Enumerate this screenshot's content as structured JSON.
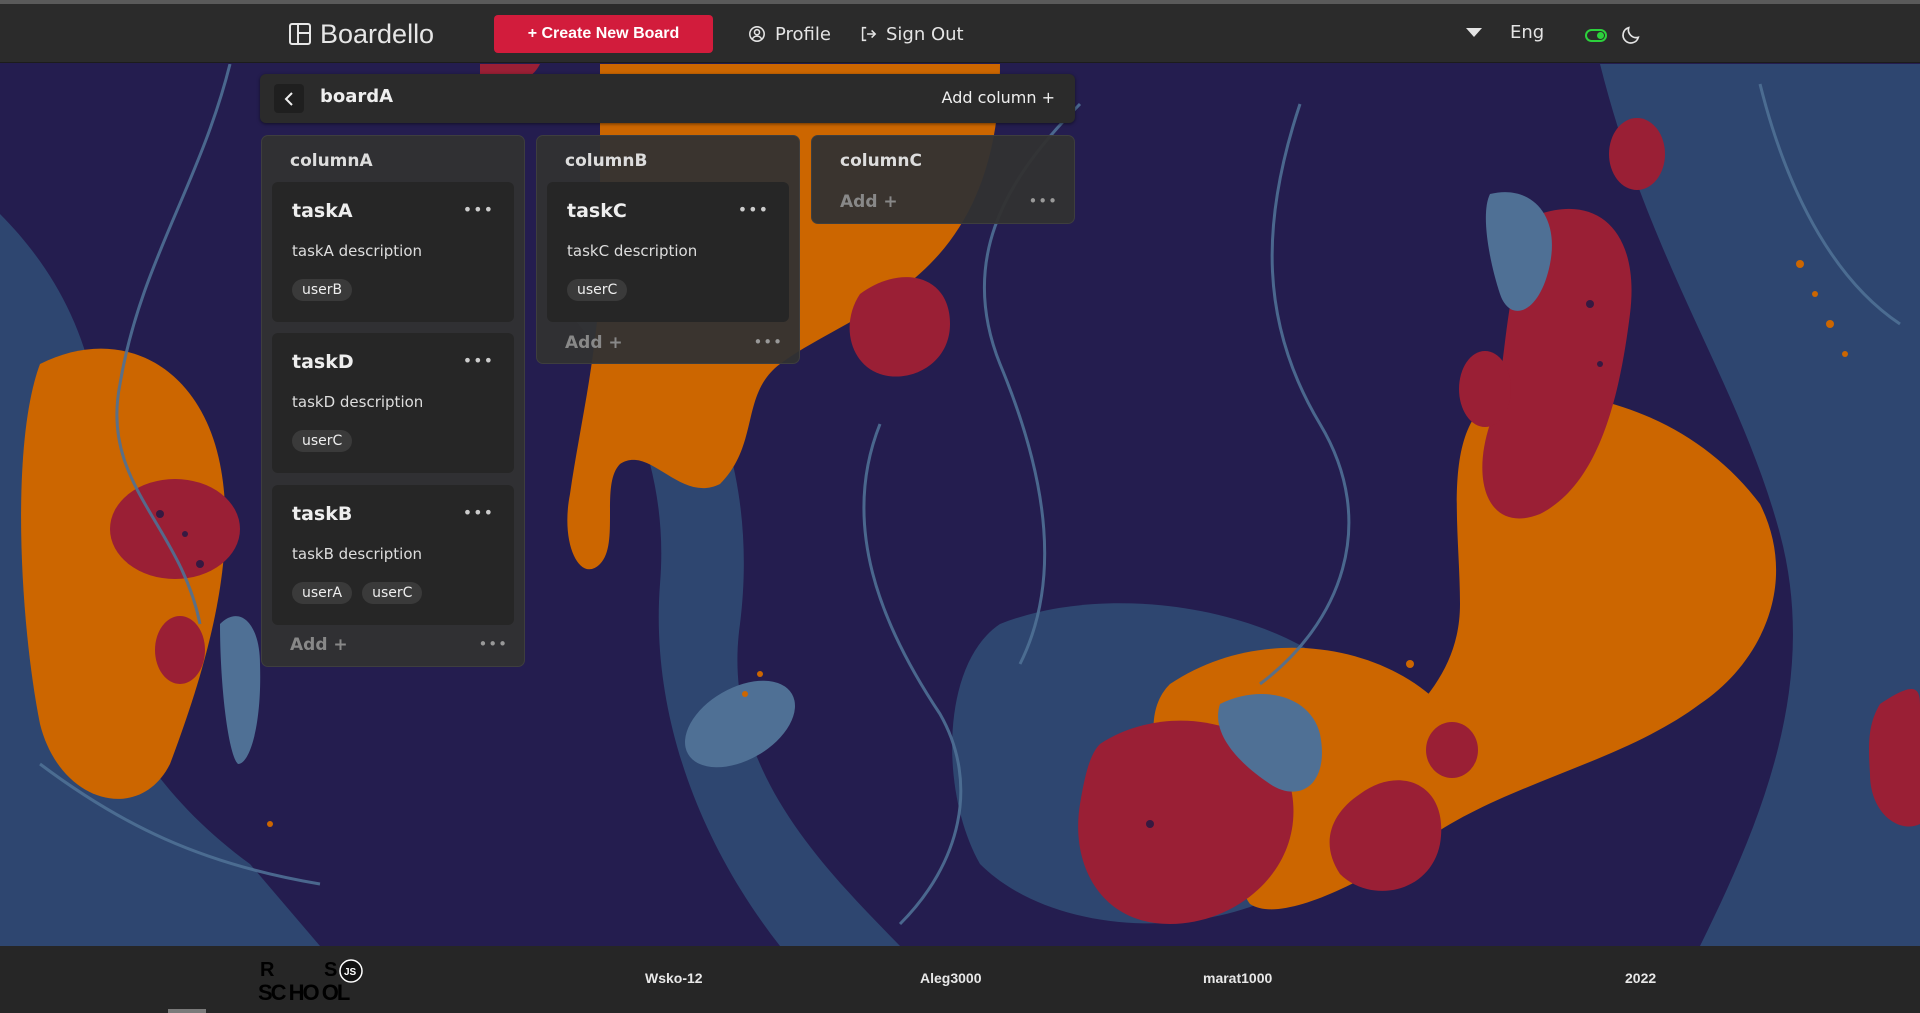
{
  "header": {
    "brand": "Boardello",
    "create_button": "+ Create New Board",
    "profile": "Profile",
    "sign_out": "Sign Out",
    "language": "Eng"
  },
  "board": {
    "title": "boardA",
    "add_column": "Add column +",
    "columns": [
      {
        "title": "columnA",
        "add": "Add +",
        "tasks": [
          {
            "title": "taskA",
            "description": "taskA description",
            "users": [
              "userB"
            ]
          },
          {
            "title": "taskD",
            "description": "taskD description",
            "users": [
              "userC"
            ]
          },
          {
            "title": "taskB",
            "description": "taskB description",
            "users": [
              "userA",
              "userC"
            ]
          }
        ]
      },
      {
        "title": "columnB",
        "add": "Add +",
        "tasks": [
          {
            "title": "taskC",
            "description": "taskC description",
            "users": [
              "userC"
            ]
          }
        ]
      },
      {
        "title": "columnC",
        "add": "Add +",
        "tasks": []
      }
    ]
  },
  "footer": {
    "authors": [
      "Wsko-12",
      "Aleg3000",
      "marat1000"
    ],
    "year": "2022",
    "logo_text": "RS SCHOOL JS"
  },
  "colors": {
    "accent": "#d21c3c",
    "header_bg": "#2b2b2b",
    "toggle": "#2cd13c",
    "bg_navy": "#241d4f",
    "bg_orange": "#cc6600",
    "bg_red": "#9a1f35",
    "bg_steel": "#4f7095"
  }
}
